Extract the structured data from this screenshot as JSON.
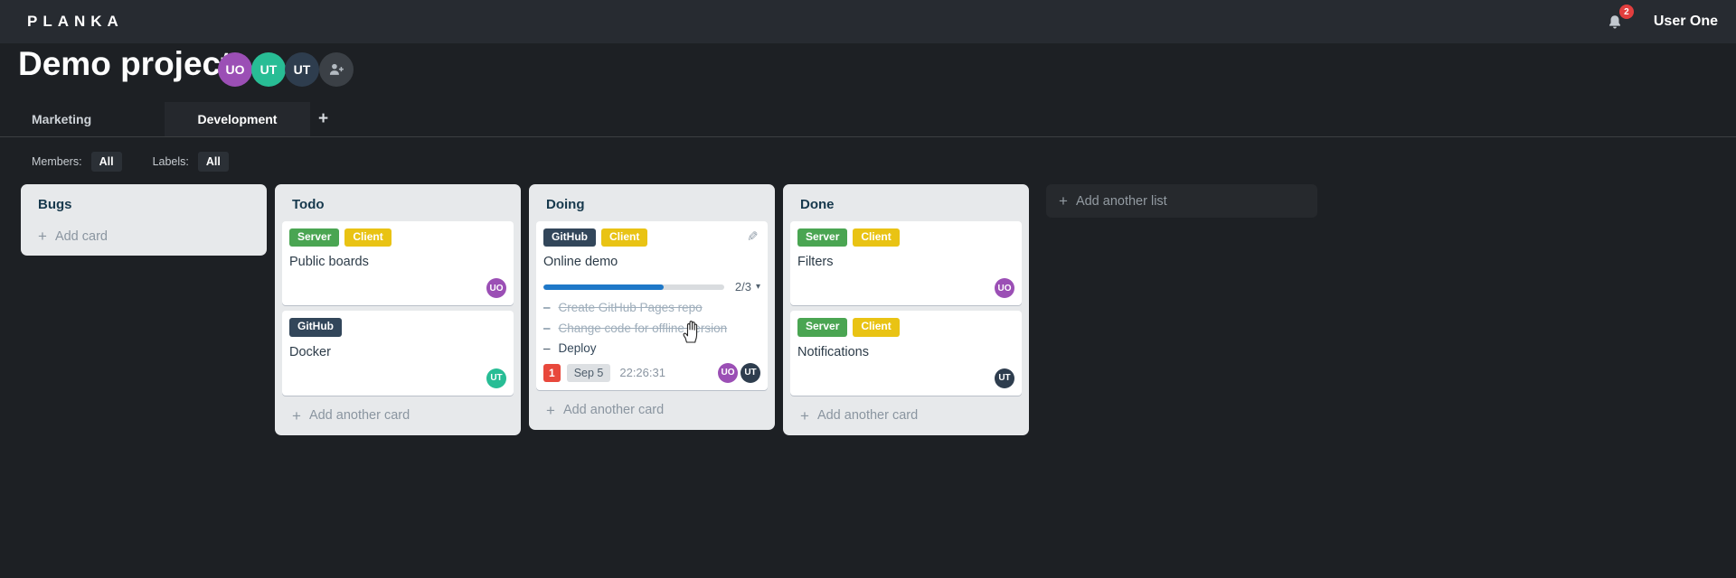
{
  "topbar": {
    "logo": "PLANKA",
    "notification_count": "2",
    "user_name": "User One"
  },
  "project": {
    "title": "Demo project",
    "members": [
      {
        "initials": "UO",
        "color": "#9b4fb5"
      },
      {
        "initials": "UT",
        "color": "#28bd95"
      },
      {
        "initials": "UT",
        "color": "#2e3d4e"
      }
    ]
  },
  "tabs": {
    "items": [
      {
        "label": "Marketing",
        "active": false
      },
      {
        "label": "Development",
        "active": true
      }
    ]
  },
  "filters": {
    "members_label": "Members:",
    "members_value": "All",
    "labels_label": "Labels:",
    "labels_value": "All"
  },
  "icons": {
    "add": "+",
    "caret": "▾",
    "edit": "✎"
  },
  "board": {
    "add_list_label": "Add another list",
    "lists": [
      {
        "name": "Bugs",
        "add_label": "Add card",
        "cards": []
      },
      {
        "name": "Todo",
        "add_label": "Add another card",
        "cards": [
          {
            "title": "Public boards",
            "labels": [
              {
                "text": "Server",
                "color": "#4aa552"
              },
              {
                "text": "Client",
                "color": "#e9c314"
              }
            ],
            "members": [
              {
                "initials": "UO",
                "color": "#9b4fb5"
              }
            ]
          },
          {
            "title": "Docker",
            "labels": [
              {
                "text": "GitHub",
                "color": "#32465a"
              }
            ],
            "members": [
              {
                "initials": "UT",
                "color": "#28bd95"
              }
            ]
          }
        ]
      },
      {
        "name": "Doing",
        "add_label": "Add another card",
        "cards": [
          {
            "title": "Online demo",
            "labels": [
              {
                "text": "GitHub",
                "color": "#32465a"
              },
              {
                "text": "Client",
                "color": "#e9c314"
              }
            ],
            "edit_icon": true,
            "progress": {
              "done": 2,
              "total": 3,
              "label": "2/3",
              "percent": 66.7,
              "color": "#1e78c8"
            },
            "tasks": [
              {
                "text": "Create GitHub Pages repo",
                "completed": true
              },
              {
                "text": "Change code for offline version",
                "completed": true
              },
              {
                "text": "Deploy",
                "completed": false
              }
            ],
            "notification_count": "1",
            "due_date": "Sep 5",
            "timer": "22:26:31",
            "members": [
              {
                "initials": "UO",
                "color": "#9b4fb5"
              },
              {
                "initials": "UT",
                "color": "#2e3d4e"
              }
            ]
          }
        ]
      },
      {
        "name": "Done",
        "add_label": "Add another card",
        "cards": [
          {
            "title": "Filters",
            "labels": [
              {
                "text": "Server",
                "color": "#4aa552"
              },
              {
                "text": "Client",
                "color": "#e9c314"
              }
            ],
            "members": [
              {
                "initials": "UO",
                "color": "#9b4fb5"
              }
            ]
          },
          {
            "title": "Notifications",
            "labels": [
              {
                "text": "Server",
                "color": "#4aa552"
              },
              {
                "text": "Client",
                "color": "#e9c314"
              }
            ],
            "members": [
              {
                "initials": "UT",
                "color": "#2e3d4e"
              }
            ]
          }
        ]
      }
    ]
  }
}
